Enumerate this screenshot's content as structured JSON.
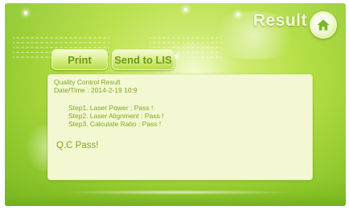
{
  "header": {
    "title": "Result",
    "home_icon": "home-icon"
  },
  "toolbar": {
    "print_label": "Print",
    "send_label": "Send to LIS"
  },
  "result_panel": {
    "title": "Quality Control Result",
    "datetime": "Date/Time : 2014-2-19 10:9",
    "steps": [
      "Step1. Laser Power :   Pass !",
      "Step2. Laser Alignment :   Pass !",
      "Step3. Calculate Ratio :  Pass !"
    ],
    "summary": "Q.C Pass!"
  },
  "colors": {
    "background": "#b8e048",
    "text_green": "#7aa91f",
    "panel_bg": "#f4f8d2"
  }
}
